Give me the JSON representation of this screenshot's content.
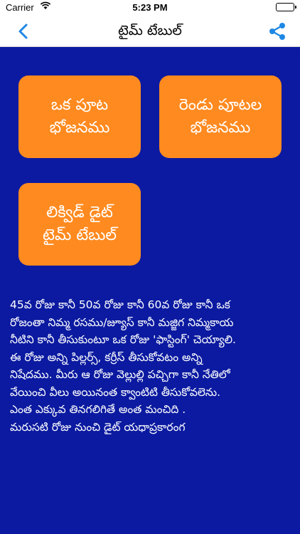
{
  "status_bar": {
    "carrier": "Carrier",
    "time": "5:23 PM"
  },
  "nav": {
    "title": "టైమ్ టేబుల్",
    "back_icon": "chevron-left-icon",
    "share_icon": "share-icon",
    "accent_color": "#1e88e5"
  },
  "colors": {
    "background": "#0b1aa0",
    "tile": "#ff8a1f",
    "text": "#ffffff"
  },
  "tiles": [
    {
      "line1": "ఒక పూట",
      "line2": "భోజనము"
    },
    {
      "line1": "రెండు పూటల",
      "line2": "భోజనము"
    },
    {
      "line1": "లిక్విడ్ డైట్",
      "line2": "టైమ్ టేబుల్"
    }
  ],
  "description": {
    "lines": [
      " 45వ రోజు కానీ 50వ రోజు కానీ 60వ రోజు కానీ ఒక",
      "రోజంతా నిమ్మ రసము/జ్యూస్ కానీ మజ్జిగ నిమ్మకాయ",
      "నీటిని కానీ తీసుకుంటూ ఒక రోజు 'ఫాస్టింగ్' చెయ్యాలి.",
      "ఈ రోజు అన్ని పిల్లర్స్, కర్రీస్ తీసుకోవటం అన్ని",
      "నిషేదము. మీరు ఆ రోజు వెల్లుల్లి పచ్చిగా కానీ నేతిలో",
      "వేయించి వీలు అయినంత క్వాంటిటి తీసుకోవలెను.",
      "ఎంత ఎక్కువ తినగలిగితే అంత మంచిది .",
      "మరుసటి రోజు నుంచి డైట్ యధాప్రకారంగ"
    ]
  }
}
